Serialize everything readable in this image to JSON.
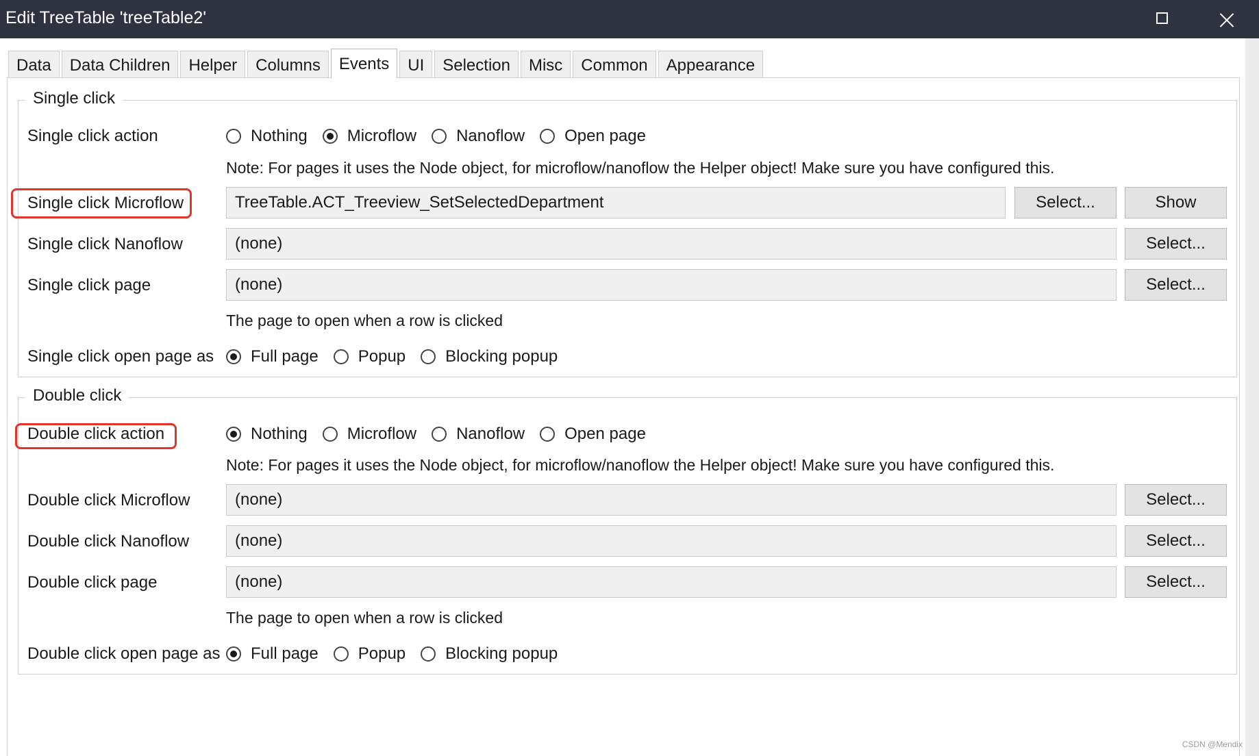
{
  "window": {
    "title": "Edit TreeTable 'treeTable2'"
  },
  "tabs": [
    {
      "label": "Data"
    },
    {
      "label": "Data Children"
    },
    {
      "label": "Helper"
    },
    {
      "label": "Columns"
    },
    {
      "label": "Events",
      "active": true
    },
    {
      "label": "UI"
    },
    {
      "label": "Selection"
    },
    {
      "label": "Misc"
    },
    {
      "label": "Common"
    },
    {
      "label": "Appearance"
    }
  ],
  "single_click": {
    "legend": "Single click",
    "action_label": "Single click action",
    "action_options": [
      "Nothing",
      "Microflow",
      "Nanoflow",
      "Open page"
    ],
    "action_selected": "Microflow",
    "note": "Note: For pages it uses the Node object, for microflow/nanoflow the Helper object! Make sure you have configured this.",
    "microflow_label": "Single click Microflow",
    "microflow_value": "TreeTable.ACT_Treeview_SetSelectedDepartment",
    "nanoflow_label": "Single click Nanoflow",
    "nanoflow_value": "(none)",
    "page_label": "Single click page",
    "page_value": "(none)",
    "page_hint": "The page to open when a row is clicked",
    "open_as_label": "Single click open page as",
    "open_as_options": [
      "Full page",
      "Popup",
      "Blocking popup"
    ],
    "open_as_selected": "Full page"
  },
  "double_click": {
    "legend": "Double click",
    "action_label": "Double click action",
    "action_options": [
      "Nothing",
      "Microflow",
      "Nanoflow",
      "Open page"
    ],
    "action_selected": "Nothing",
    "note": "Note: For pages it uses the Node object, for microflow/nanoflow the Helper object! Make sure you have configured this.",
    "microflow_label": "Double click Microflow",
    "microflow_value": "(none)",
    "nanoflow_label": "Double click Nanoflow",
    "nanoflow_value": "(none)",
    "page_label": "Double click page",
    "page_value": "(none)",
    "page_hint": "The page to open when a row is clicked",
    "open_as_label": "Double click open page as",
    "open_as_options": [
      "Full page",
      "Popup",
      "Blocking popup"
    ],
    "open_as_selected": "Full page"
  },
  "buttons": {
    "select": "Select...",
    "show": "Show"
  },
  "watermark": "CSDN @Mendix",
  "colors": {
    "titlebar": "#2f3241",
    "highlight": "#e0362a"
  }
}
